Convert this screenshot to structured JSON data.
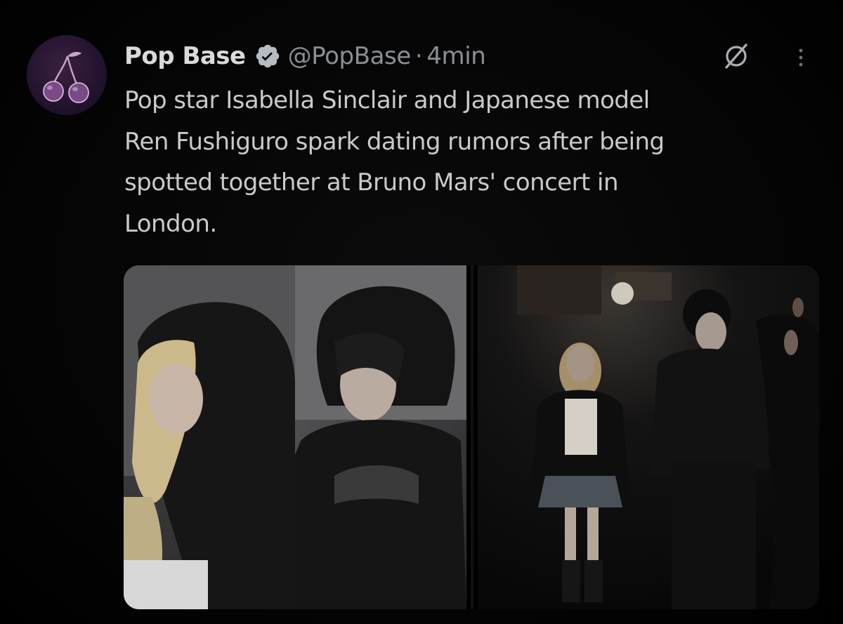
{
  "tweet": {
    "author_name": "Pop Base",
    "handle": "@PopBase",
    "separator": "·",
    "time": "4min",
    "text": "Pop star Isabella Sinclair and Japanese model\nRen Fushiguro spark dating rumors after being\nspotted together at Bruno Mars' concert in\nLondon.",
    "avatar_icon": "cherry-icon",
    "verified_icon": "verified-badge-icon",
    "grok_icon": "grok-icon",
    "more_icon": "more-options-icon",
    "media": [
      {
        "kind": "photo",
        "subject": "portrait-left"
      },
      {
        "kind": "photo",
        "subject": "portrait-middle"
      },
      {
        "kind": "photo",
        "subject": "street-photo-right"
      }
    ]
  },
  "colors": {
    "background": "#000000",
    "name": "#d9dadb",
    "secondary_text": "#8b8f94",
    "body_text": "#c9cacc",
    "verified": "#1d9bf0"
  }
}
